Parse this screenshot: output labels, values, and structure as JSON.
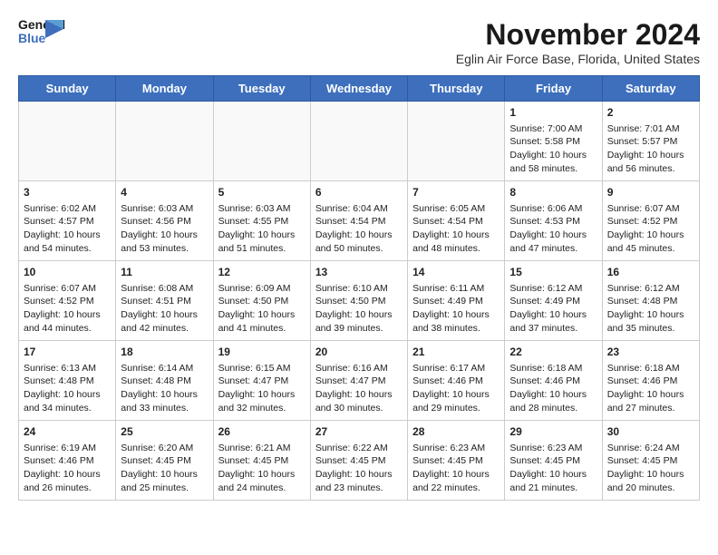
{
  "header": {
    "logo_line1": "General",
    "logo_line2": "Blue",
    "month_title": "November 2024",
    "location": "Eglin Air Force Base, Florida, United States"
  },
  "days_of_week": [
    "Sunday",
    "Monday",
    "Tuesday",
    "Wednesday",
    "Thursday",
    "Friday",
    "Saturday"
  ],
  "weeks": [
    [
      {
        "day": "",
        "empty": true
      },
      {
        "day": "",
        "empty": true
      },
      {
        "day": "",
        "empty": true
      },
      {
        "day": "",
        "empty": true
      },
      {
        "day": "",
        "empty": true
      },
      {
        "day": "1",
        "sunrise": "7:00 AM",
        "sunset": "5:58 PM",
        "daylight": "10 hours and 58 minutes."
      },
      {
        "day": "2",
        "sunrise": "7:01 AM",
        "sunset": "5:57 PM",
        "daylight": "10 hours and 56 minutes."
      }
    ],
    [
      {
        "day": "3",
        "sunrise": "6:02 AM",
        "sunset": "4:57 PM",
        "daylight": "10 hours and 54 minutes."
      },
      {
        "day": "4",
        "sunrise": "6:03 AM",
        "sunset": "4:56 PM",
        "daylight": "10 hours and 53 minutes."
      },
      {
        "day": "5",
        "sunrise": "6:03 AM",
        "sunset": "4:55 PM",
        "daylight": "10 hours and 51 minutes."
      },
      {
        "day": "6",
        "sunrise": "6:04 AM",
        "sunset": "4:54 PM",
        "daylight": "10 hours and 50 minutes."
      },
      {
        "day": "7",
        "sunrise": "6:05 AM",
        "sunset": "4:54 PM",
        "daylight": "10 hours and 48 minutes."
      },
      {
        "day": "8",
        "sunrise": "6:06 AM",
        "sunset": "4:53 PM",
        "daylight": "10 hours and 47 minutes."
      },
      {
        "day": "9",
        "sunrise": "6:07 AM",
        "sunset": "4:52 PM",
        "daylight": "10 hours and 45 minutes."
      }
    ],
    [
      {
        "day": "10",
        "sunrise": "6:07 AM",
        "sunset": "4:52 PM",
        "daylight": "10 hours and 44 minutes."
      },
      {
        "day": "11",
        "sunrise": "6:08 AM",
        "sunset": "4:51 PM",
        "daylight": "10 hours and 42 minutes."
      },
      {
        "day": "12",
        "sunrise": "6:09 AM",
        "sunset": "4:50 PM",
        "daylight": "10 hours and 41 minutes."
      },
      {
        "day": "13",
        "sunrise": "6:10 AM",
        "sunset": "4:50 PM",
        "daylight": "10 hours and 39 minutes."
      },
      {
        "day": "14",
        "sunrise": "6:11 AM",
        "sunset": "4:49 PM",
        "daylight": "10 hours and 38 minutes."
      },
      {
        "day": "15",
        "sunrise": "6:12 AM",
        "sunset": "4:49 PM",
        "daylight": "10 hours and 37 minutes."
      },
      {
        "day": "16",
        "sunrise": "6:12 AM",
        "sunset": "4:48 PM",
        "daylight": "10 hours and 35 minutes."
      }
    ],
    [
      {
        "day": "17",
        "sunrise": "6:13 AM",
        "sunset": "4:48 PM",
        "daylight": "10 hours and 34 minutes."
      },
      {
        "day": "18",
        "sunrise": "6:14 AM",
        "sunset": "4:48 PM",
        "daylight": "10 hours and 33 minutes."
      },
      {
        "day": "19",
        "sunrise": "6:15 AM",
        "sunset": "4:47 PM",
        "daylight": "10 hours and 32 minutes."
      },
      {
        "day": "20",
        "sunrise": "6:16 AM",
        "sunset": "4:47 PM",
        "daylight": "10 hours and 30 minutes."
      },
      {
        "day": "21",
        "sunrise": "6:17 AM",
        "sunset": "4:46 PM",
        "daylight": "10 hours and 29 minutes."
      },
      {
        "day": "22",
        "sunrise": "6:18 AM",
        "sunset": "4:46 PM",
        "daylight": "10 hours and 28 minutes."
      },
      {
        "day": "23",
        "sunrise": "6:18 AM",
        "sunset": "4:46 PM",
        "daylight": "10 hours and 27 minutes."
      }
    ],
    [
      {
        "day": "24",
        "sunrise": "6:19 AM",
        "sunset": "4:46 PM",
        "daylight": "10 hours and 26 minutes."
      },
      {
        "day": "25",
        "sunrise": "6:20 AM",
        "sunset": "4:45 PM",
        "daylight": "10 hours and 25 minutes."
      },
      {
        "day": "26",
        "sunrise": "6:21 AM",
        "sunset": "4:45 PM",
        "daylight": "10 hours and 24 minutes."
      },
      {
        "day": "27",
        "sunrise": "6:22 AM",
        "sunset": "4:45 PM",
        "daylight": "10 hours and 23 minutes."
      },
      {
        "day": "28",
        "sunrise": "6:23 AM",
        "sunset": "4:45 PM",
        "daylight": "10 hours and 22 minutes."
      },
      {
        "day": "29",
        "sunrise": "6:23 AM",
        "sunset": "4:45 PM",
        "daylight": "10 hours and 21 minutes."
      },
      {
        "day": "30",
        "sunrise": "6:24 AM",
        "sunset": "4:45 PM",
        "daylight": "10 hours and 20 minutes."
      }
    ]
  ]
}
